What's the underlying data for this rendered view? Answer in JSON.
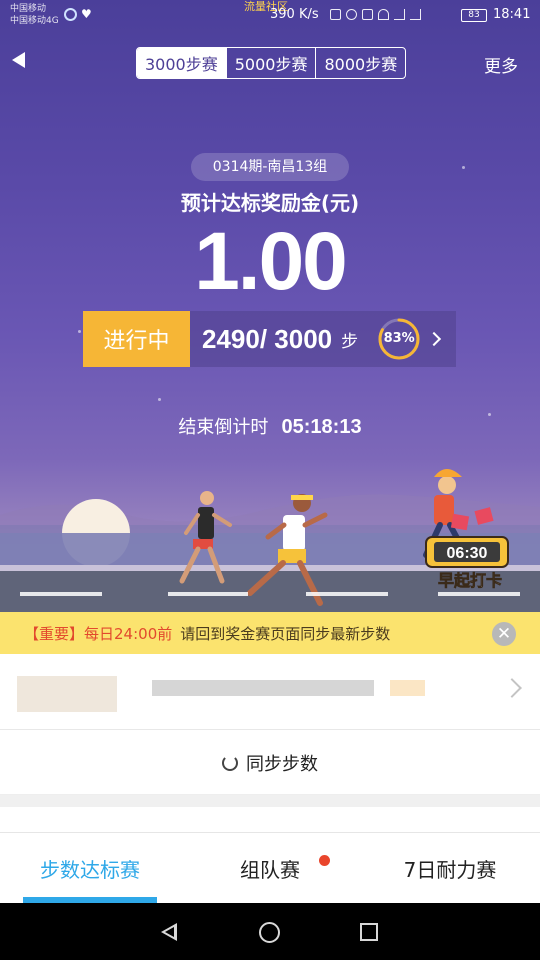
{
  "status_bar": {
    "carrier_1": "中国移动",
    "carrier_2": "中国移动4G",
    "notification": "流量社区",
    "speed": "390 K/s",
    "battery": "83",
    "time": "18:41"
  },
  "top_nav": {
    "tabs": [
      "3000步赛",
      "5000步赛",
      "8000步赛"
    ],
    "selected_tab": "3000步赛",
    "more_label": "更多",
    "back_icon": "back-triangle-icon"
  },
  "prize": {
    "period": "0314期-南昌13组",
    "label": "预计达标奖励金(元)",
    "amount": "1.00"
  },
  "progress": {
    "status": "进行中",
    "steps_text": "2490/ 3000",
    "unit": "步",
    "percent_label": "83%",
    "percent_value": 0.83
  },
  "countdown": {
    "label": "结束倒计时",
    "time": "05:18:13"
  },
  "illustration": {
    "badge_time": "06:30",
    "badge_text": "早起打卡"
  },
  "notice": {
    "tag": "【重要】",
    "time": "每日24:00前",
    "body": "请回到奖金赛页面同步最新步数"
  },
  "sync": {
    "label": "同步步数"
  },
  "bottom_tabs": [
    "步数达标赛",
    "组队赛",
    "7日耐力赛"
  ],
  "colors": {
    "accent": "#2fa8e8",
    "status_pill": "#f6b636",
    "notice_bg": "#fbe36e",
    "notice_red": "#e2492d"
  }
}
